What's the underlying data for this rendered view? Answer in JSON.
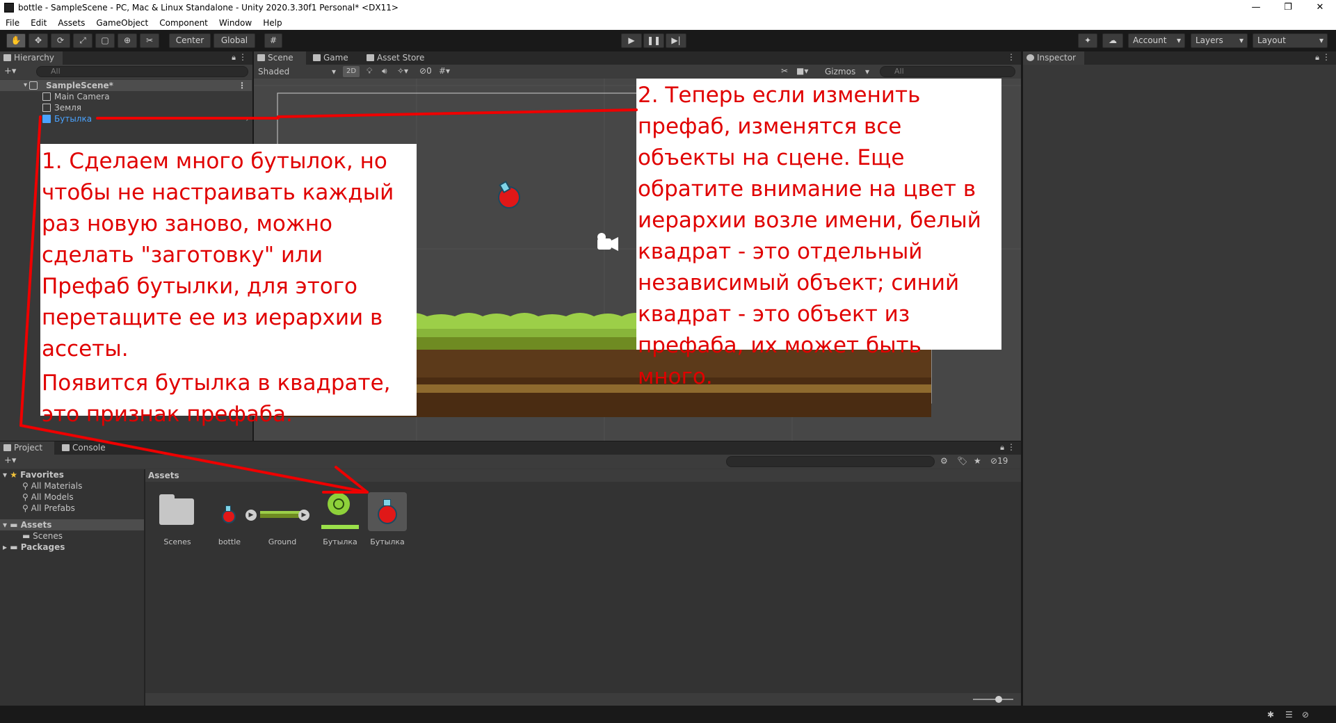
{
  "window": {
    "title": "bottle - SampleScene - PC, Mac & Linux Standalone - Unity 2020.3.30f1 Personal* <DX11>",
    "controls": [
      "—",
      "❐",
      "✕"
    ]
  },
  "menu": [
    "File",
    "Edit",
    "Assets",
    "GameObject",
    "Component",
    "Window",
    "Help"
  ],
  "toolbar": {
    "pivot_label": "Center",
    "space_label": "Global",
    "account_label": "Account",
    "layers_label": "Layers",
    "layout_label": "Layout"
  },
  "hierarchy": {
    "tab": "Hierarchy",
    "search_placeholder": "All",
    "scene": "SampleScene*",
    "items": [
      {
        "label": "Main Camera",
        "prefab": false
      },
      {
        "label": "Земля",
        "prefab": false
      },
      {
        "label": "Бутылка",
        "prefab": true
      }
    ]
  },
  "scene_view": {
    "tabs": [
      "Scene",
      "Game",
      "Asset Store"
    ],
    "shading": "Shaded",
    "mode_2d": "2D",
    "hidden_count": "0",
    "gizmos": "Gizmos",
    "search_placeholder": "All"
  },
  "inspector": {
    "tab": "Inspector"
  },
  "project": {
    "tabs": [
      "Project",
      "Console"
    ],
    "favorites_label": "Favorites",
    "favorites": [
      "All Materials",
      "All Models",
      "All Prefabs"
    ],
    "assets_label": "Assets",
    "asset_folders": [
      "Scenes"
    ],
    "packages_label": "Packages",
    "breadcrumb": "Assets",
    "hidden_count": "19",
    "assets": [
      {
        "label": "Scenes",
        "kind": "folder"
      },
      {
        "label": "bottle",
        "kind": "sprite"
      },
      {
        "label": "Ground",
        "kind": "sprite"
      },
      {
        "label": "Бутылка",
        "kind": "prefab-variant"
      },
      {
        "label": "Бутылка",
        "kind": "prefab",
        "selected": true
      }
    ]
  },
  "annotations": {
    "note1_p1": "1. Сделаем много бутылок, но чтобы не настраивать каждый раз новую заново, можно сделать \"заготовку\" или Префаб бутылки, для этого перетащите ее из иерархии в ассеты.",
    "note1_p2": "Появится бутылка в квадрате, это признак префаба.",
    "note2": "2. Теперь если изменить префаб, изменятся все объекты на сцене. Еще обратите внимание на цвет в иерархии возле имени, белый квадрат - это отдельный независимый объект; синий квадрат - это объект из префаба, их может быть много."
  },
  "colors": {
    "annotation_red": "#e00000",
    "prefab_blue": "#4aa3ff",
    "editor_bg": "#383838",
    "panel_dark": "#282828"
  }
}
